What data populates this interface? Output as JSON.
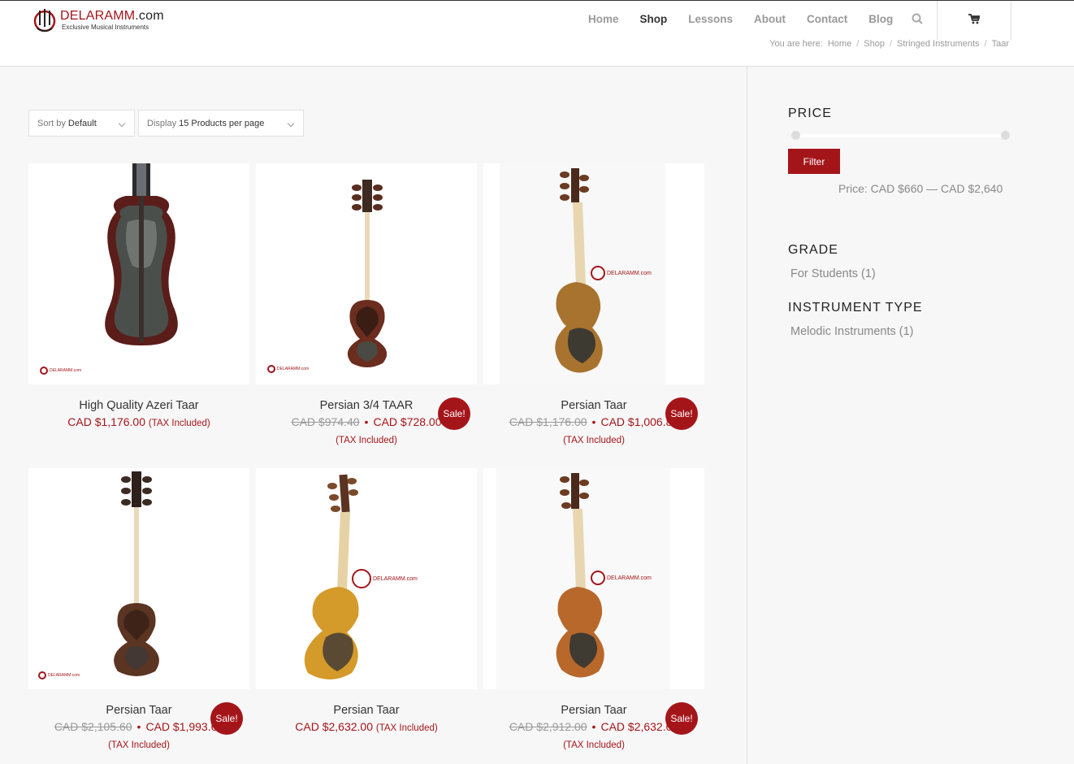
{
  "header": {
    "logo_name_red": "DELARAMM",
    "logo_name_rest": ".com",
    "logo_tagline": "Exclusive Musical Instruments",
    "nav": [
      "Home",
      "Shop",
      "Lessons",
      "About",
      "Contact",
      "Blog"
    ],
    "active_nav": "Shop",
    "search_icon": "search-icon",
    "cart_icon": "cart-icon"
  },
  "breadcrumb": {
    "prefix": "You are here:",
    "items": [
      "Home",
      "Shop",
      "Stringed Instruments",
      "Taar"
    ]
  },
  "toolbar": {
    "sort_prefix": "Sort by",
    "sort_value": "Default",
    "display_prefix": "Display",
    "display_value": "15 Products per page"
  },
  "products": [
    {
      "title": "High Quality Azeri Taar",
      "old_price": "",
      "price": "CAD $1,176.00",
      "tax": "(TAX Included)",
      "sale": false
    },
    {
      "title": "Persian 3/4 TAAR",
      "old_price": "CAD $974.40",
      "price": "CAD $728.00",
      "tax": "(TAX Included)",
      "sale": true
    },
    {
      "title": "Persian Taar",
      "old_price": "CAD $1,176.00",
      "price": "CAD $1,006.88",
      "tax": "(TAX Included)",
      "sale": true
    },
    {
      "title": "Persian Taar",
      "old_price": "CAD $2,105.60",
      "price": "CAD $1,993.60",
      "tax": "(TAX Included)",
      "sale": true
    },
    {
      "title": "Persian Taar",
      "old_price": "",
      "price": "CAD $2,632.00",
      "tax": "(TAX Included)",
      "sale": false
    },
    {
      "title": "Persian Taar",
      "old_price": "CAD $2,912.00",
      "price": "CAD $2,632.00",
      "tax": "(TAX Included)",
      "sale": true
    }
  ],
  "sale_label": "Sale!",
  "watermark": "DELARAMM.com",
  "sidebar": {
    "price_title": "PRICE",
    "filter_label": "Filter",
    "price_range": "Price: CAD $660 — CAD $2,640",
    "grade_title": "GRADE",
    "grade_item": "For Students (1)",
    "type_title": "INSTRUMENT TYPE",
    "type_item": "Melodic Instruments (1)"
  },
  "colors": {
    "accent": "#a4151a"
  }
}
